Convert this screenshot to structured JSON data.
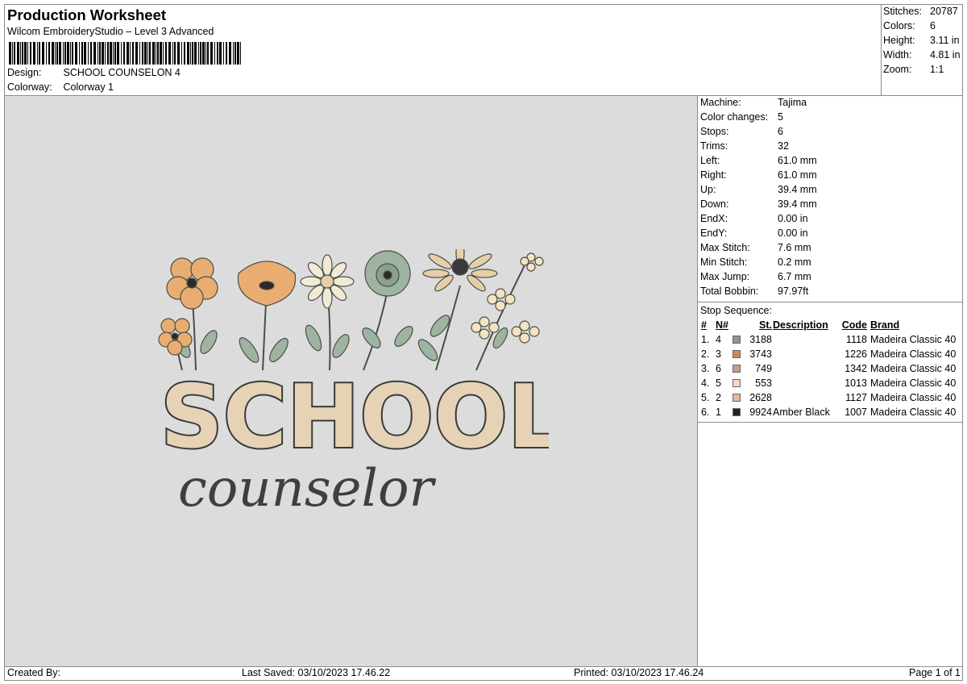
{
  "header": {
    "title": "Production Worksheet",
    "software": "Wilcom EmbroideryStudio – Level 3 Advanced",
    "design_label": "Design:",
    "design_value": "SCHOOL COUNSELON 4",
    "colorway_label": "Colorway:",
    "colorway_value": "Colorway 1"
  },
  "summary": [
    {
      "label": "Stitches:",
      "value": "20787"
    },
    {
      "label": "Colors:",
      "value": "6"
    },
    {
      "label": "Height:",
      "value": "3.11 in"
    },
    {
      "label": "Width:",
      "value": "4.81 in"
    },
    {
      "label": "Zoom:",
      "value": "1:1"
    }
  ],
  "specs": [
    {
      "label": "Machine:",
      "value": "Tajima"
    },
    {
      "label": "Color changes:",
      "value": "5"
    },
    {
      "label": "Stops:",
      "value": "6"
    },
    {
      "label": "Trims:",
      "value": "32"
    },
    {
      "label": "Left:",
      "value": "61.0 mm"
    },
    {
      "label": "Right:",
      "value": "61.0 mm"
    },
    {
      "label": "Up:",
      "value": "39.4 mm"
    },
    {
      "label": "Down:",
      "value": "39.4 mm"
    },
    {
      "label": "EndX:",
      "value": "0.00 in"
    },
    {
      "label": "EndY:",
      "value": "0.00 in"
    },
    {
      "label": "Max Stitch:",
      "value": "7.6 mm"
    },
    {
      "label": "Min Stitch:",
      "value": "0.2 mm"
    },
    {
      "label": "Max Jump:",
      "value": "6.7 mm"
    },
    {
      "label": "Total Bobbin:",
      "value": "97.97ft"
    }
  ],
  "stop_sequence": {
    "title": "Stop Sequence:",
    "columns": {
      "num": "#",
      "n": "N#",
      "st": "St.",
      "desc": "Description",
      "code": "Code",
      "brand": "Brand"
    },
    "rows": [
      {
        "num": "1.",
        "n": "4",
        "color": "#8a9a8c",
        "st": "3188",
        "desc": "",
        "code": "1118",
        "brand": "Madeira Classic 40"
      },
      {
        "num": "2.",
        "n": "3",
        "color": "#d18a55",
        "st": "3743",
        "desc": "",
        "code": "1226",
        "brand": "Madeira Classic 40"
      },
      {
        "num": "3.",
        "n": "6",
        "color": "#c99a86",
        "st": "749",
        "desc": "",
        "code": "1342",
        "brand": "Madeira Classic 40"
      },
      {
        "num": "4.",
        "n": "5",
        "color": "#f2d4c8",
        "st": "553",
        "desc": "",
        "code": "1013",
        "brand": "Madeira Classic 40"
      },
      {
        "num": "5.",
        "n": "2",
        "color": "#e3b89c",
        "st": "2628",
        "desc": "",
        "code": "1127",
        "brand": "Madeira Classic 40"
      },
      {
        "num": "6.",
        "n": "1",
        "color": "#222222",
        "st": "9924",
        "desc": "Amber Black",
        "code": "1007",
        "brand": "Madeira Classic 40"
      }
    ]
  },
  "design_preview": {
    "word_top": "SCHOOL",
    "word_bottom": "counselor"
  },
  "footer": {
    "created_by": "Created By:",
    "last_saved": "Last Saved: 03/10/2023 17.46.22",
    "printed": "Printed: 03/10/2023 17.46.24",
    "page": "Page 1 of 1"
  }
}
